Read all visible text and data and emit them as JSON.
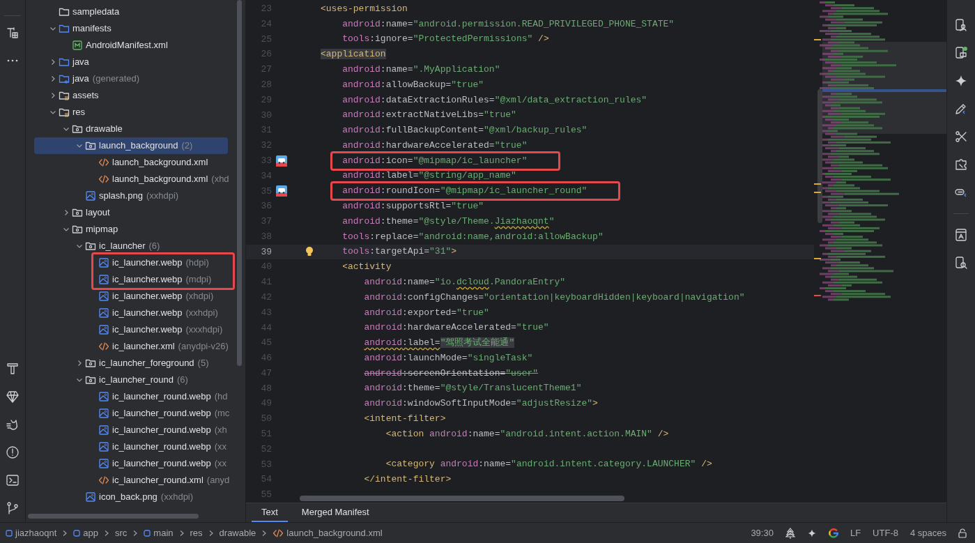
{
  "project_tree": {
    "items": [
      {
        "name": "sampledata",
        "kind": "plain-folder",
        "selected": false,
        "annotated": false
      },
      {
        "name": "manifests",
        "kind": "source-folder",
        "expanded": true,
        "selected": false,
        "annotated": false,
        "children": [
          {
            "name": "AndroidManifest.xml",
            "kind": "manifest",
            "selected": false,
            "annotated": false
          }
        ]
      },
      {
        "name": "java",
        "kind": "source-folder",
        "expanded": false,
        "selected": false,
        "annotated": false
      },
      {
        "name": "java",
        "note": "(generated)",
        "kind": "generated-folder",
        "expanded": false,
        "selected": false,
        "annotated": false
      },
      {
        "name": "assets",
        "kind": "resource-root",
        "expanded": false,
        "selected": false,
        "annotated": false
      },
      {
        "name": "res",
        "kind": "resource-root",
        "expanded": true,
        "selected": false,
        "annotated": false,
        "children": [
          {
            "name": "drawable",
            "kind": "resource-dir",
            "expanded": true,
            "selected": false,
            "annotated": false,
            "children": [
              {
                "name": "launch_background",
                "note": "(2)",
                "kind": "resource-dir",
                "expanded": true,
                "selected": true,
                "annotated": false,
                "children": [
                  {
                    "name": "launch_background.xml",
                    "kind": "xml",
                    "selected": false,
                    "annotated": false
                  },
                  {
                    "name": "launch_background.xml",
                    "note": "(xhd",
                    "kind": "xml",
                    "selected": false,
                    "annotated": false
                  }
                ]
              },
              {
                "name": "splash.png",
                "note": "(xxhdpi)",
                "kind": "image",
                "selected": false,
                "annotated": false
              }
            ]
          },
          {
            "name": "layout",
            "kind": "resource-dir",
            "expanded": false,
            "selected": false,
            "annotated": false
          },
          {
            "name": "mipmap",
            "kind": "resource-dir",
            "expanded": true,
            "selected": false,
            "annotated": false,
            "children": [
              {
                "name": "ic_launcher",
                "note": "(6)",
                "kind": "resource-dir",
                "expanded": true,
                "selected": false,
                "annotated": false,
                "children": [
                  {
                    "name": "ic_launcher.webp",
                    "note": "(hdpi)",
                    "kind": "image",
                    "selected": false,
                    "annotated": true
                  },
                  {
                    "name": "ic_launcher.webp",
                    "note": "(mdpi)",
                    "kind": "image",
                    "selected": false,
                    "annotated": true
                  },
                  {
                    "name": "ic_launcher.webp",
                    "note": "(xhdpi)",
                    "kind": "image",
                    "selected": false,
                    "annotated": false
                  },
                  {
                    "name": "ic_launcher.webp",
                    "note": "(xxhdpi)",
                    "kind": "image",
                    "selected": false,
                    "annotated": false
                  },
                  {
                    "name": "ic_launcher.webp",
                    "note": "(xxxhdpi)",
                    "kind": "image",
                    "selected": false,
                    "annotated": false
                  },
                  {
                    "name": "ic_launcher.xml",
                    "note": "(anydpi-v26)",
                    "kind": "xml",
                    "selected": false,
                    "annotated": false
                  }
                ]
              },
              {
                "name": "ic_launcher_foreground",
                "note": "(5)",
                "kind": "resource-dir",
                "expanded": false,
                "selected": false,
                "annotated": false
              },
              {
                "name": "ic_launcher_round",
                "note": "(6)",
                "kind": "resource-dir",
                "expanded": true,
                "selected": false,
                "annotated": false,
                "children": [
                  {
                    "name": "ic_launcher_round.webp",
                    "note": "(hd",
                    "kind": "image",
                    "selected": false,
                    "annotated": false
                  },
                  {
                    "name": "ic_launcher_round.webp",
                    "note": "(mc",
                    "kind": "image",
                    "selected": false,
                    "annotated": false
                  },
                  {
                    "name": "ic_launcher_round.webp",
                    "note": "(xh",
                    "kind": "image",
                    "selected": false,
                    "annotated": false
                  },
                  {
                    "name": "ic_launcher_round.webp",
                    "note": "(xx",
                    "kind": "image",
                    "selected": false,
                    "annotated": false
                  },
                  {
                    "name": "ic_launcher_round.webp",
                    "note": "(xx",
                    "kind": "image",
                    "selected": false,
                    "annotated": false
                  },
                  {
                    "name": "ic_launcher_round.xml",
                    "note": "(anyd",
                    "kind": "xml",
                    "selected": false,
                    "annotated": false
                  }
                ]
              },
              {
                "name": "icon_back.png",
                "note": "(xxhdpi)",
                "kind": "image",
                "selected": false,
                "annotated": false
              }
            ]
          }
        ]
      }
    ]
  },
  "editor": {
    "lines": [
      {
        "number": "23",
        "current": false,
        "annotated": false,
        "tokens": [
          {
            "t": "<uses-permission",
            "kind": "tag"
          }
        ]
      },
      {
        "number": "24",
        "current": false,
        "annotated": false,
        "tokens": [
          {
            "t": "    android",
            "kind": "ns"
          },
          {
            "t": ":name=",
            "kind": "attr"
          },
          {
            "t": "\"android.permission.READ_PRIVILEGED_PHONE_STATE\"",
            "kind": "string"
          }
        ]
      },
      {
        "number": "25",
        "current": false,
        "annotated": false,
        "tokens": [
          {
            "t": "    tools",
            "kind": "ns"
          },
          {
            "t": ":ignore=",
            "kind": "attr"
          },
          {
            "t": "\"ProtectedPermissions\"",
            "kind": "string"
          },
          {
            "t": " />",
            "kind": "tag"
          }
        ]
      },
      {
        "number": "26",
        "current": false,
        "annotated": false,
        "tokens": [
          {
            "t": "<application",
            "kind": "tag-matched"
          }
        ]
      },
      {
        "number": "27",
        "current": false,
        "annotated": false,
        "tokens": [
          {
            "t": "    android",
            "kind": "ns"
          },
          {
            "t": ":name=",
            "kind": "attr"
          },
          {
            "t": "\".MyApplication\"",
            "kind": "string"
          }
        ]
      },
      {
        "number": "28",
        "current": false,
        "annotated": false,
        "tokens": [
          {
            "t": "    android",
            "kind": "ns"
          },
          {
            "t": ":allowBackup=",
            "kind": "attr"
          },
          {
            "t": "\"true\"",
            "kind": "string"
          }
        ]
      },
      {
        "number": "29",
        "current": false,
        "annotated": false,
        "tokens": [
          {
            "t": "    android",
            "kind": "ns"
          },
          {
            "t": ":dataExtractionRules=",
            "kind": "attr"
          },
          {
            "t": "\"@xml/data_extraction_rules\"",
            "kind": "string"
          }
        ]
      },
      {
        "number": "30",
        "current": false,
        "annotated": false,
        "tokens": [
          {
            "t": "    android",
            "kind": "ns"
          },
          {
            "t": ":extractNativeLibs=",
            "kind": "attr"
          },
          {
            "t": "\"true\"",
            "kind": "string"
          }
        ]
      },
      {
        "number": "31",
        "current": false,
        "annotated": false,
        "tokens": [
          {
            "t": "    android",
            "kind": "ns"
          },
          {
            "t": ":fullBackupContent=",
            "kind": "attr"
          },
          {
            "t": "\"@xml/backup_rules\"",
            "kind": "string"
          }
        ]
      },
      {
        "number": "32",
        "current": false,
        "annotated": false,
        "tokens": [
          {
            "t": "    android",
            "kind": "ns"
          },
          {
            "t": ":hardwareAccelerated=",
            "kind": "attr"
          },
          {
            "t": "\"true\"",
            "kind": "string"
          }
        ]
      },
      {
        "number": "33",
        "current": false,
        "annotated": true,
        "gutter": {
          "kind": "image"
        },
        "tokens": [
          {
            "t": "    android",
            "kind": "ns"
          },
          {
            "t": ":icon=",
            "kind": "attr"
          },
          {
            "t": "\"@mipmap/ic_launcher\"",
            "kind": "string"
          }
        ]
      },
      {
        "number": "34",
        "current": false,
        "annotated": false,
        "tokens": [
          {
            "t": "    android",
            "kind": "ns"
          },
          {
            "t": ":label=",
            "kind": "attr"
          },
          {
            "t": "\"@string/app_name\"",
            "kind": "string"
          }
        ]
      },
      {
        "number": "35",
        "current": false,
        "annotated": true,
        "gutter": {
          "kind": "image"
        },
        "tokens": [
          {
            "t": "    android",
            "kind": "ns"
          },
          {
            "t": ":roundIcon=",
            "kind": "attr"
          },
          {
            "t": "\"@mipmap/ic_launcher_round\"",
            "kind": "string"
          }
        ]
      },
      {
        "number": "36",
        "current": false,
        "annotated": false,
        "tokens": [
          {
            "t": "    android",
            "kind": "ns"
          },
          {
            "t": ":supportsRtl=",
            "kind": "attr"
          },
          {
            "t": "\"true\"",
            "kind": "string"
          }
        ]
      },
      {
        "number": "37",
        "current": false,
        "annotated": false,
        "tokens": [
          {
            "t": "    android",
            "kind": "ns"
          },
          {
            "t": ":theme=",
            "kind": "attr"
          },
          {
            "t": "\"@style/Theme.",
            "kind": "string"
          },
          {
            "t": "Jiazhaoqnt",
            "kind": "string-typo"
          },
          {
            "t": "\"",
            "kind": "string"
          }
        ]
      },
      {
        "number": "38",
        "current": false,
        "annotated": false,
        "tokens": [
          {
            "t": "    tools",
            "kind": "ns"
          },
          {
            "t": ":replace=",
            "kind": "attr"
          },
          {
            "t": "\"android:name,android:allowBackup\"",
            "kind": "string"
          }
        ]
      },
      {
        "number": "39",
        "current": true,
        "annotated": false,
        "gutter": {
          "kind": "bulb"
        },
        "tokens": [
          {
            "t": "    tools",
            "kind": "ns"
          },
          {
            "t": ":targetApi=",
            "kind": "attr"
          },
          {
            "t": "\"31\"",
            "kind": "string"
          },
          {
            "t": ">",
            "kind": "tag"
          }
        ]
      },
      {
        "number": "40",
        "current": false,
        "annotated": false,
        "tokens": [
          {
            "t": "    <activity",
            "kind": "tag"
          }
        ]
      },
      {
        "number": "41",
        "current": false,
        "annotated": false,
        "tokens": [
          {
            "t": "        android",
            "kind": "ns"
          },
          {
            "t": ":name=",
            "kind": "attr"
          },
          {
            "t": "\"io.",
            "kind": "string"
          },
          {
            "t": "dcloud",
            "kind": "string-typo"
          },
          {
            "t": ".PandoraEntry\"",
            "kind": "string"
          }
        ]
      },
      {
        "number": "42",
        "current": false,
        "annotated": false,
        "tokens": [
          {
            "t": "        android",
            "kind": "ns"
          },
          {
            "t": ":configChanges=",
            "kind": "attr"
          },
          {
            "t": "\"orientation|keyboardHidden|keyboard|navigation\"",
            "kind": "string"
          }
        ]
      },
      {
        "number": "43",
        "current": false,
        "annotated": false,
        "tokens": [
          {
            "t": "        android",
            "kind": "ns"
          },
          {
            "t": ":exported=",
            "kind": "attr"
          },
          {
            "t": "\"true\"",
            "kind": "string"
          }
        ]
      },
      {
        "number": "44",
        "current": false,
        "annotated": false,
        "tokens": [
          {
            "t": "        android",
            "kind": "ns"
          },
          {
            "t": ":hardwareAccelerated=",
            "kind": "attr"
          },
          {
            "t": "\"true\"",
            "kind": "string"
          }
        ]
      },
      {
        "number": "45",
        "current": false,
        "annotated": false,
        "tokens": [
          {
            "t": "        android",
            "kind": "ns-warning"
          },
          {
            "t": ":label=",
            "kind": "attr-warning"
          },
          {
            "t": "\"驾照考试全能通\"",
            "kind": "string-highlighted"
          }
        ]
      },
      {
        "number": "46",
        "current": false,
        "annotated": false,
        "tokens": [
          {
            "t": "        android",
            "kind": "ns"
          },
          {
            "t": ":launchMode=",
            "kind": "attr"
          },
          {
            "t": "\"singleTask\"",
            "kind": "string"
          }
        ]
      },
      {
        "number": "47",
        "current": false,
        "annotated": false,
        "tokens": [
          {
            "t": "        android",
            "kind": "ns-deprecated"
          },
          {
            "t": ":screenOrientation=",
            "kind": "attr-deprecated"
          },
          {
            "t": "\"user\"",
            "kind": "string-deprecated"
          }
        ]
      },
      {
        "number": "48",
        "current": false,
        "annotated": false,
        "tokens": [
          {
            "t": "        android",
            "kind": "ns"
          },
          {
            "t": ":theme=",
            "kind": "attr"
          },
          {
            "t": "\"@style/TranslucentTheme1\"",
            "kind": "string"
          }
        ]
      },
      {
        "number": "49",
        "current": false,
        "annotated": false,
        "tokens": [
          {
            "t": "        android",
            "kind": "ns"
          },
          {
            "t": ":windowSoftInputMode=",
            "kind": "attr"
          },
          {
            "t": "\"adjustResize\"",
            "kind": "string"
          },
          {
            "t": ">",
            "kind": "tag"
          }
        ]
      },
      {
        "number": "50",
        "current": false,
        "annotated": false,
        "tokens": [
          {
            "t": "        <intent-filter>",
            "kind": "tag"
          }
        ]
      },
      {
        "number": "51",
        "current": false,
        "annotated": false,
        "tokens": [
          {
            "t": "            <action",
            "kind": "tag"
          },
          {
            "t": " android",
            "kind": "ns"
          },
          {
            "t": ":name=",
            "kind": "attr"
          },
          {
            "t": "\"android.intent.action.MAIN\"",
            "kind": "string"
          },
          {
            "t": " />",
            "kind": "tag"
          }
        ]
      },
      {
        "number": "52",
        "current": false,
        "annotated": false
      },
      {
        "number": "53",
        "current": false,
        "annotated": false,
        "tokens": [
          {
            "t": "            <category",
            "kind": "tag"
          },
          {
            "t": " android",
            "kind": "ns"
          },
          {
            "t": ":name=",
            "kind": "attr"
          },
          {
            "t": "\"android.intent.category.LAUNCHER\"",
            "kind": "string"
          },
          {
            "t": " />",
            "kind": "tag"
          }
        ]
      },
      {
        "number": "54",
        "current": false,
        "annotated": false,
        "tokens": [
          {
            "t": "        </intent-filter>",
            "kind": "tag"
          }
        ]
      },
      {
        "number": "55",
        "current": false,
        "annotated": false
      }
    ],
    "tabs": [
      {
        "label": "Text",
        "selected": true
      },
      {
        "label": "Merged Manifest",
        "selected": false
      }
    ]
  },
  "status_bar": {
    "breadcrumbs": [
      {
        "label": "jiazhaoqnt",
        "kind": "module"
      },
      {
        "label": "app",
        "kind": "module"
      },
      {
        "label": "src",
        "kind": "folder"
      },
      {
        "label": "main",
        "kind": "module"
      },
      {
        "label": "res",
        "kind": "folder"
      },
      {
        "label": "drawable",
        "kind": "folder"
      },
      {
        "label": "launch_background.xml",
        "kind": "xml"
      }
    ],
    "position": "39:30",
    "line_separator": "LF",
    "encoding": "UTF-8",
    "indentation": "4 spaces"
  }
}
